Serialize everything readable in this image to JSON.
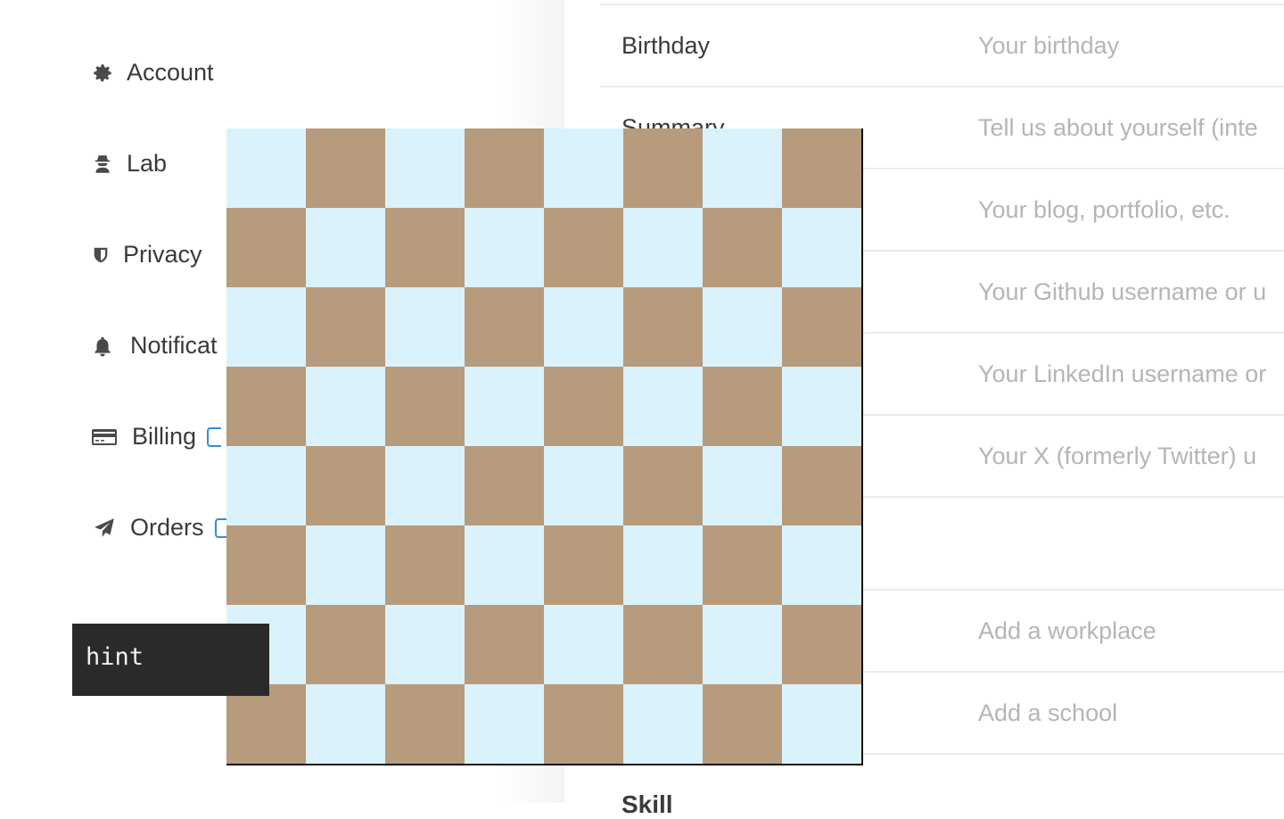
{
  "sidebar": {
    "items": [
      {
        "label": "Account",
        "icon": "gear-icon"
      },
      {
        "label": "Lab",
        "icon": "spy-icon"
      },
      {
        "label": "Privacy",
        "icon": "shield-icon"
      },
      {
        "label": "Notificat",
        "icon": "bell-icon"
      },
      {
        "label": "Billing",
        "icon": "credit-card-icon"
      },
      {
        "label": "Orders",
        "icon": "paper-plane-icon"
      }
    ]
  },
  "profile": {
    "rows": [
      {
        "label": "Birthday",
        "placeholder": "Your birthday"
      },
      {
        "label": "Summary",
        "placeholder": "Tell us about yourself (inte"
      },
      {
        "label": "",
        "placeholder": "Your blog, portfolio, etc."
      },
      {
        "label": "",
        "placeholder": "Your Github username or u"
      },
      {
        "label": "",
        "placeholder": "Your LinkedIn username or"
      },
      {
        "label": "",
        "placeholder": "Your X (formerly Twitter) u"
      },
      {
        "label": "",
        "placeholder": "Add a workplace"
      },
      {
        "label": "",
        "placeholder": "Add a school"
      }
    ],
    "section_fragment": "Skill"
  },
  "board": {
    "size": 8,
    "light_color": "#daf2fb",
    "dark_color": "#b69b7c"
  },
  "hint": {
    "label": "hint"
  }
}
